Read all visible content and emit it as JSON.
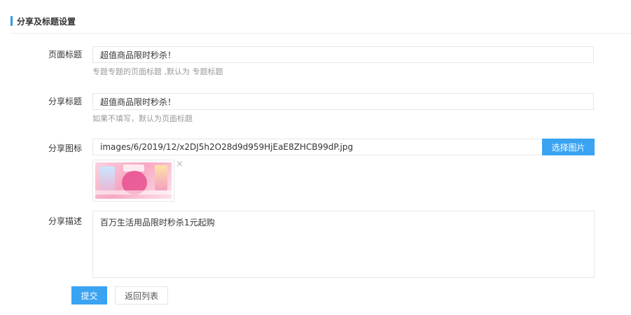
{
  "section": {
    "title": "分享及标题设置"
  },
  "form": {
    "page_title": {
      "label": "页面标题",
      "value": "超值商品限时秒杀！",
      "hint": "专题专题的页面标题 ,默认为 专题标题"
    },
    "share_title": {
      "label": "分享标题",
      "value": "超值商品限时秒杀！",
      "hint": "如果不填写，默认为页面标题"
    },
    "share_icon": {
      "label": "分享图标",
      "path": "images/6/2019/12/x2DJ5h2O28d9d959HjEaE8ZHCB99dP.jpg",
      "select_label": "选择图片",
      "remove_icon": "×"
    },
    "share_desc": {
      "label": "分享描述",
      "value": "百万生活用品限时秒杀1元起购"
    }
  },
  "actions": {
    "submit_label": "提交",
    "back_label": "返回列表"
  },
  "colors": {
    "accent": "#3aa3f2",
    "section_bar": "#2f9de3",
    "border": "#e3e6eb",
    "hint": "#999999"
  }
}
